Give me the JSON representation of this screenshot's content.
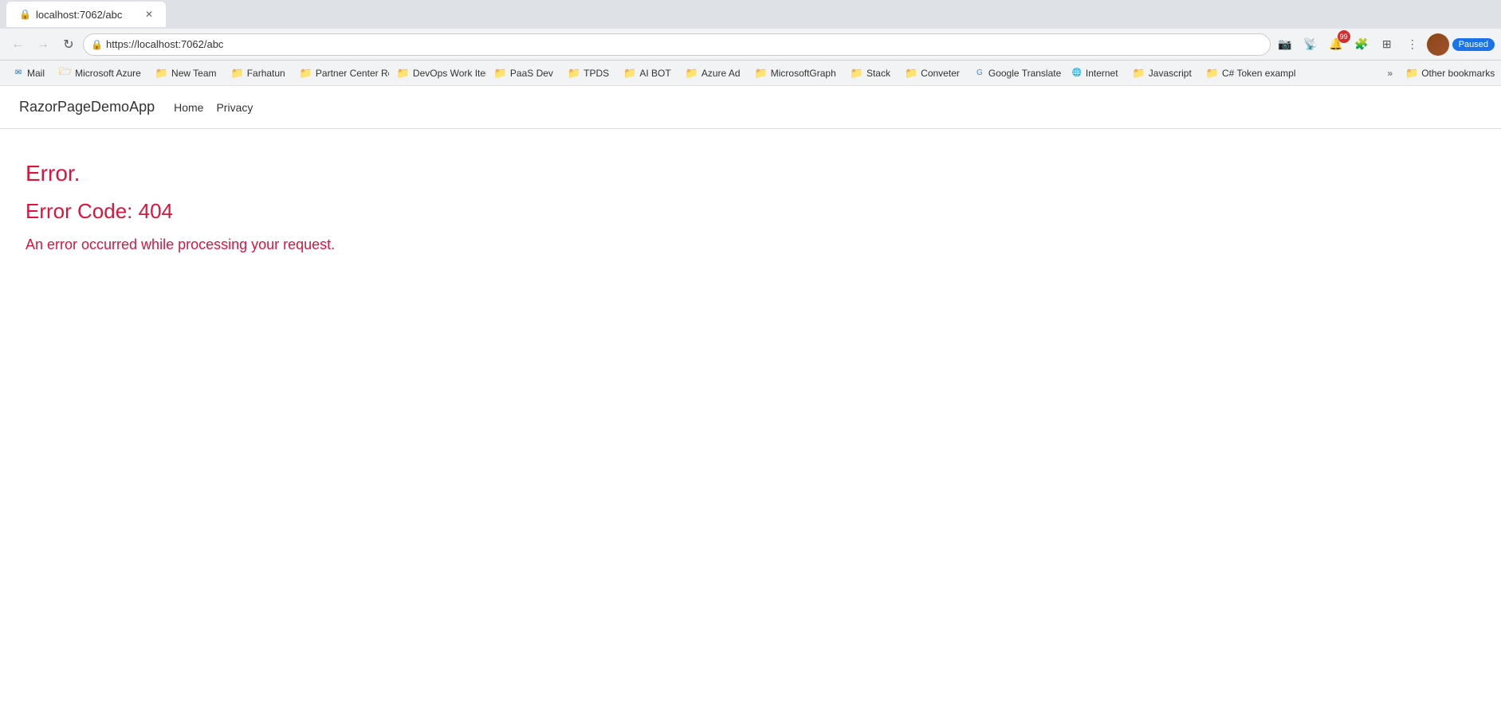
{
  "browser": {
    "tab": {
      "title": "localhost:7062/abc",
      "favicon": "🔒"
    },
    "address_bar": {
      "url": "https://localhost:7062/abc",
      "lock_icon": "🔒"
    },
    "buttons": {
      "back": "←",
      "forward": "→",
      "refresh": "↻",
      "home": "⌂"
    },
    "nav_icons": {
      "download": "⬇",
      "profile_toggle": "👤",
      "extensions": "🧩",
      "more": "⋮",
      "paused_label": "Paused"
    }
  },
  "bookmarks": [
    {
      "label": "Mail",
      "icon": "envelope",
      "color": "#1565C0"
    },
    {
      "label": "Microsoft Azure",
      "icon": "folder",
      "color": "#0078D4"
    },
    {
      "label": "New Team",
      "icon": "folder",
      "color": "#FFA000"
    },
    {
      "label": "Farhatun",
      "icon": "folder",
      "color": "#FFA000"
    },
    {
      "label": "Partner Center Repo",
      "icon": "folder",
      "color": "#FFA000"
    },
    {
      "label": "DevOps Work Item",
      "icon": "folder",
      "color": "#FFA000"
    },
    {
      "label": "PaaS Dev",
      "icon": "folder",
      "color": "#FFA000"
    },
    {
      "label": "TPDS",
      "icon": "folder",
      "color": "#FFA000"
    },
    {
      "label": "AI BOT",
      "icon": "folder",
      "color": "#FFA000"
    },
    {
      "label": "Azure Ad",
      "icon": "folder",
      "color": "#FFA000"
    },
    {
      "label": "MicrosoftGraph",
      "icon": "folder",
      "color": "#FFA000"
    },
    {
      "label": "Stack",
      "icon": "folder",
      "color": "#FFA000"
    },
    {
      "label": "Conveter",
      "icon": "folder",
      "color": "#FFA000"
    },
    {
      "label": "Google Translate",
      "icon": "site",
      "color": "#4285F4"
    },
    {
      "label": "Internet",
      "icon": "globe",
      "color": "#555"
    },
    {
      "label": "Javascript",
      "icon": "folder",
      "color": "#FFA000"
    },
    {
      "label": "C# Token example",
      "icon": "folder",
      "color": "#FFA000"
    },
    {
      "label": "Other bookmarks",
      "icon": "folder",
      "color": "#FFA000"
    }
  ],
  "app": {
    "brand": "RazorPageDemoApp",
    "nav_links": [
      {
        "label": "Home"
      },
      {
        "label": "Privacy"
      }
    ]
  },
  "error": {
    "title": "Error.",
    "code_label": "Error Code: 404",
    "message": "An error occurred while processing your request."
  }
}
